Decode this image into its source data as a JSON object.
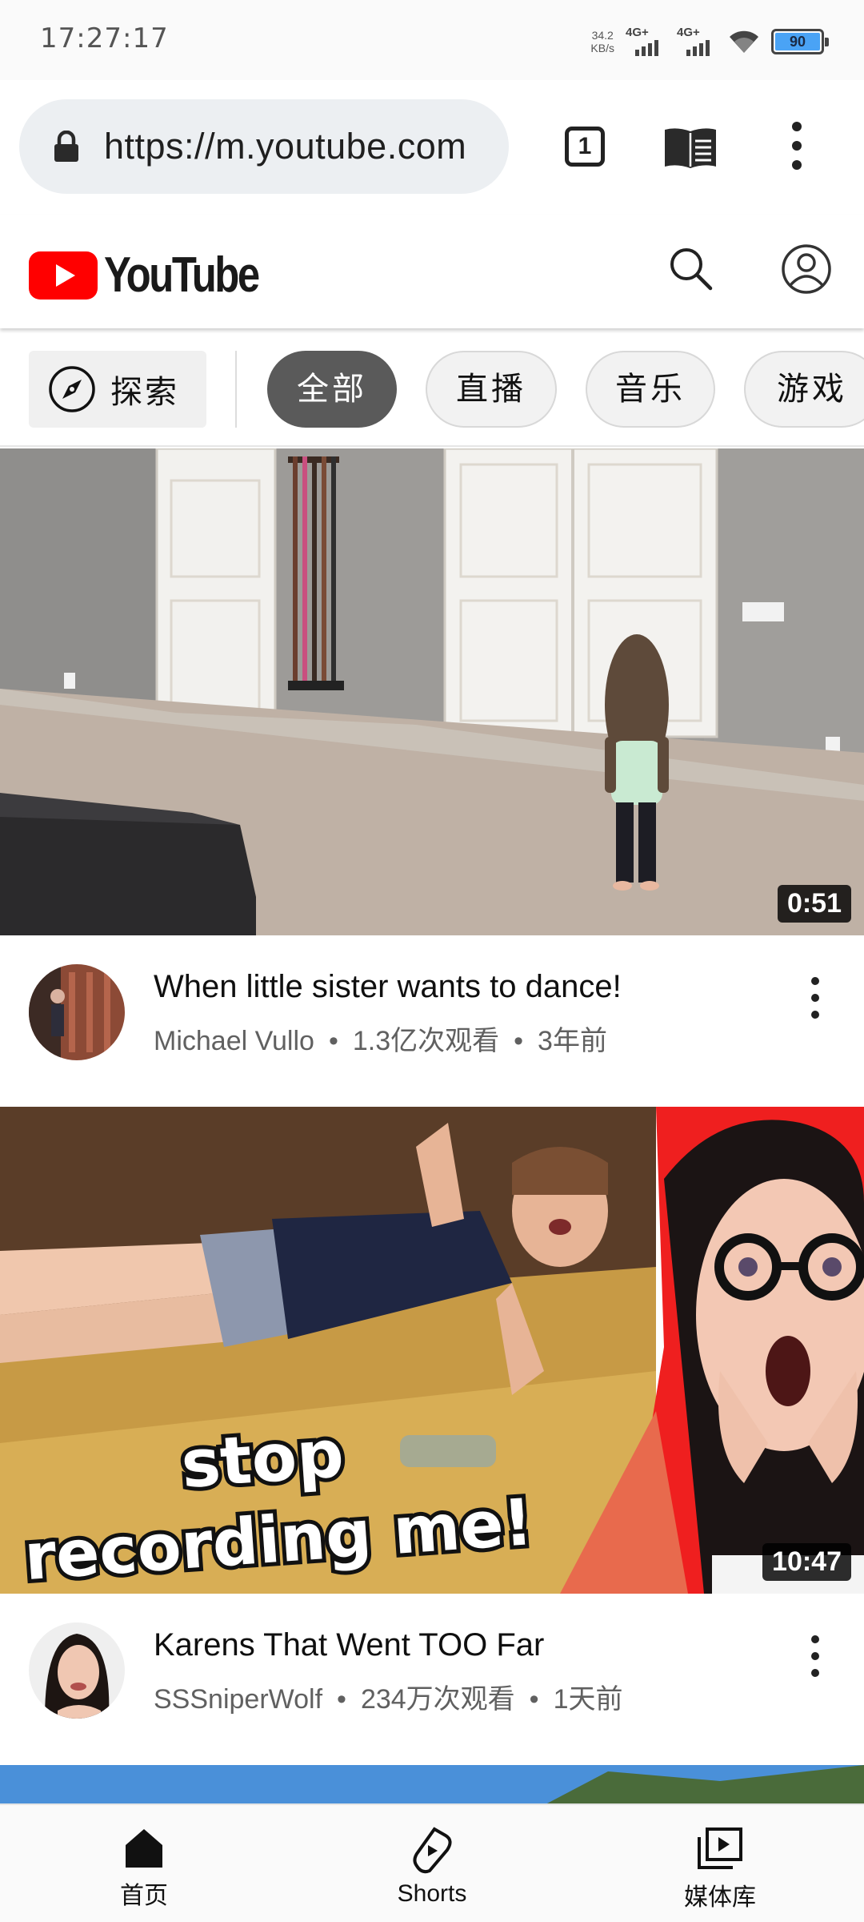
{
  "status_bar": {
    "time": "17:27:17",
    "net_speed_value": "34.2",
    "net_speed_unit": "KB/s",
    "signal1_label": "4G+",
    "signal2_label": "4G+",
    "battery": "90"
  },
  "browser": {
    "url": "https://m.youtube.com",
    "tab_count": "1"
  },
  "youtube": {
    "logo_text": "YouTube"
  },
  "chips": {
    "explore_label": "探索",
    "items": [
      {
        "label": "全部",
        "active": true
      },
      {
        "label": "直播",
        "active": false
      },
      {
        "label": "音乐",
        "active": false
      },
      {
        "label": "游戏",
        "active": false
      }
    ]
  },
  "videos": [
    {
      "title": "When little sister wants to dance!",
      "channel": "Michael Vullo",
      "views": "1.3亿次观看",
      "age": "3年前",
      "duration": "0:51"
    },
    {
      "title": "Karens That Went TOO Far",
      "channel": "SSSniperWolf",
      "views": "234万次观看",
      "age": "1天前",
      "duration": "10:47",
      "thumbnail_caption_line1": "stop",
      "thumbnail_caption_line2": "recording me!"
    }
  ],
  "separator": "•",
  "bottom_nav": {
    "items": [
      {
        "label": "首页",
        "icon": "home-icon"
      },
      {
        "label": "Shorts",
        "icon": "shorts-icon"
      },
      {
        "label": "媒体库",
        "icon": "library-icon"
      }
    ]
  },
  "colors": {
    "youtube_red": "#ff0000",
    "active_chip": "#5a5a5a",
    "battery_fill": "#4aa3f5"
  }
}
